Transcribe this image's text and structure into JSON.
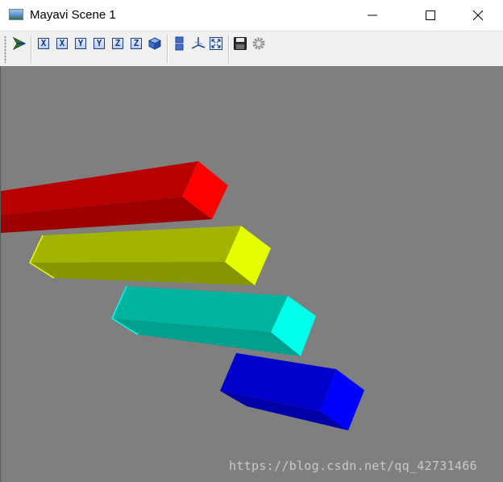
{
  "window": {
    "title": "Mayavi Scene 1",
    "controls": [
      "minimize",
      "maximize",
      "close"
    ]
  },
  "toolbar": {
    "buttons": [
      {
        "name": "mayavi-pipeline-icon"
      },
      {
        "name": "view-x-positive",
        "label": "X"
      },
      {
        "name": "view-x-negative",
        "label": "X"
      },
      {
        "name": "view-y-positive",
        "label": "Y"
      },
      {
        "name": "view-y-negative",
        "label": "Y"
      },
      {
        "name": "view-z-positive",
        "label": "Z"
      },
      {
        "name": "view-z-negative",
        "label": "Z"
      },
      {
        "name": "isometric-view-icon"
      },
      {
        "name": "toggle-parallel-projection-icon"
      },
      {
        "name": "toggle-axes-icon"
      },
      {
        "name": "full-screen-icon"
      },
      {
        "name": "save-icon"
      },
      {
        "name": "configure-scene-icon"
      }
    ]
  },
  "scene": {
    "background_color": "#7f7f7f",
    "bars": [
      {
        "color": "red",
        "front": "#ff0000",
        "top": "#b80000",
        "side": "#9c0000"
      },
      {
        "color": "yellow",
        "front": "#e6ff00",
        "top": "#a3b400",
        "side": "#869600"
      },
      {
        "color": "cyan",
        "front": "#00ffea",
        "top": "#00b4a0",
        "side": "#00a08c"
      },
      {
        "color": "blue",
        "front": "#0000ff",
        "top": "#0000cc",
        "side": "#0000a8"
      }
    ]
  },
  "watermark": "https://blog.csdn.net/qq_42731466"
}
